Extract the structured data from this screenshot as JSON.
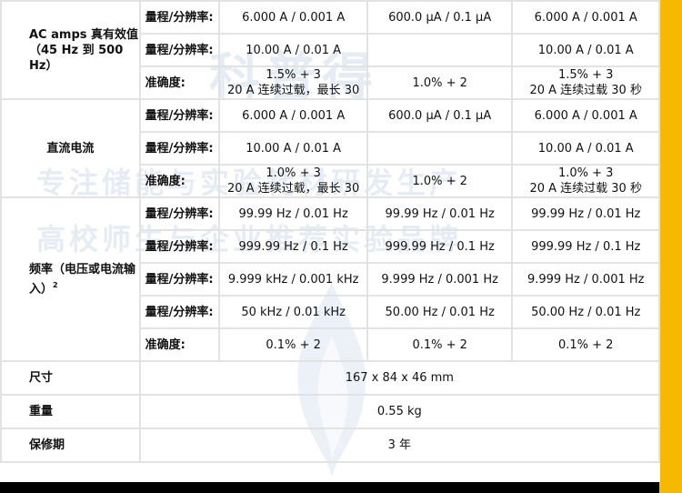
{
  "rows": {
    "ac": {
      "section": "AC amps 真有效值（45 Hz 到 500 Hz）",
      "r1": {
        "label": "量程/分辨率:",
        "c1": "6.000 A / 0.001 A",
        "c2": "600.0 µA / 0.1 µA",
        "c3": "6.000 A / 0.001 A"
      },
      "r2": {
        "label": "量程/分辨率:",
        "c1": "10.00 A / 0.01 A",
        "c2": "",
        "c3": "10.00 A / 0.01 A"
      },
      "r3": {
        "label": "准确度:",
        "c1a": "1.5% + 3",
        "c1b": "20 A 连续过载，最长 30",
        "c2": "1.0% + 2",
        "c3a": "1.5% + 3",
        "c3b": "20 A 连续过载 30 秒"
      }
    },
    "dc": {
      "section": "直流电流",
      "r1": {
        "label": "量程/分辨率:",
        "c1": "6.000 A / 0.001 A",
        "c2": "600.0 µA / 0.1 µA",
        "c3": "6.000 A / 0.001 A"
      },
      "r2": {
        "label": "量程/分辨率:",
        "c1": "10.00 A / 0.01 A",
        "c2": "",
        "c3": "10.00 A / 0.01 A"
      },
      "r3": {
        "label": "准确度:",
        "c1a": "1.0% + 3",
        "c1b": "20 A 连续过载，最长 30",
        "c2": "1.0% + 2",
        "c3a": "1.0% + 3",
        "c3b": "20 A 连续过载 30 秒"
      }
    },
    "freq": {
      "section": "频率（电压或电流输入）",
      "section_sup": "2",
      "r1": {
        "label": "量程/分辨率:",
        "c1": "99.99 Hz / 0.01 Hz",
        "c2": "99.99 Hz / 0.01 Hz",
        "c3": "99.99 Hz / 0.01 Hz"
      },
      "r2": {
        "label": "量程/分辨率:",
        "c1": "999.99 Hz / 0.1 Hz",
        "c2": "999.99 Hz / 0.1 Hz",
        "c3": "999.99 Hz / 0.1 Hz"
      },
      "r3": {
        "label": "量程/分辨率:",
        "c1": "9.999 kHz / 0.001 kHz",
        "c2": "9.999 Hz / 0.001 Hz",
        "c3": "9.999 Hz / 0.001 Hz"
      },
      "r4": {
        "label": "量程/分辨率:",
        "c1": "50 kHz / 0.01 kHz",
        "c2": "50.00 Hz / 0.01 Hz",
        "c3": "50.00 Hz / 0.01 Hz"
      },
      "r5": {
        "label": "准确度:",
        "c1": "0.1% + 2",
        "c2": "0.1% + 2",
        "c3": "0.1% + 2"
      }
    },
    "size": {
      "label": "尺寸",
      "value": "167 x 84 x 46 mm"
    },
    "weight": {
      "label": "重量",
      "value": "0.55 kg"
    },
    "warranty": {
      "label": "保修期",
      "value": "3 年"
    }
  },
  "watermark": {
    "line1": "科普得",
    "line2": "专注储能与实验耗材研发生产",
    "line3": "高校师生与企业推荐实验品牌"
  },
  "colors": {
    "frame": "#000000",
    "accent_bar": "#f6b800",
    "border": "#e2e2e2"
  }
}
